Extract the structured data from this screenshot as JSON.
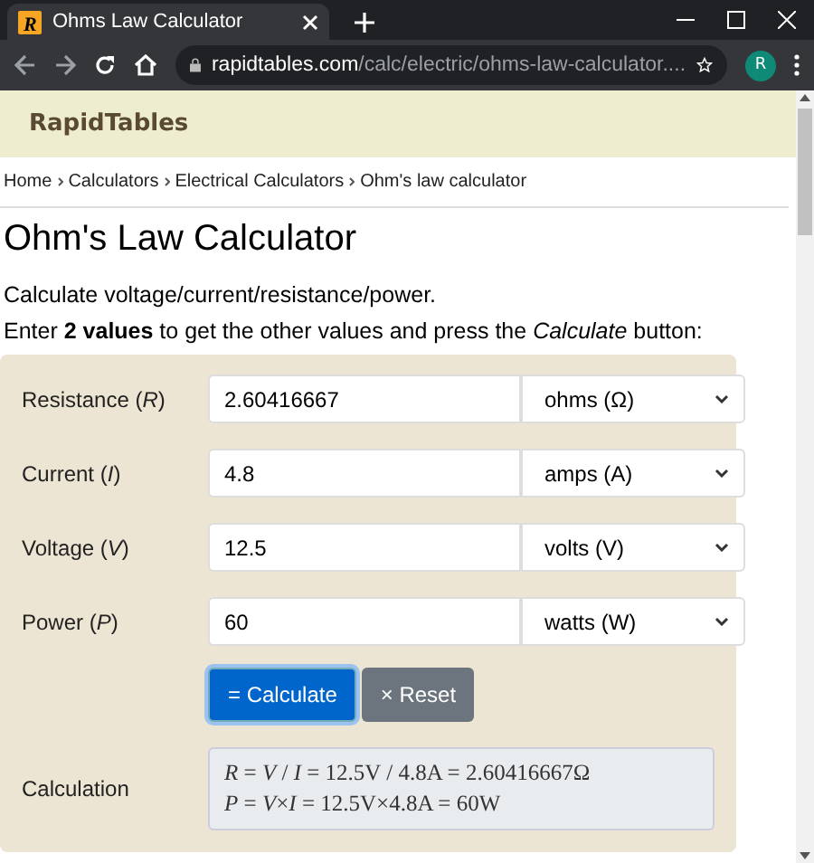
{
  "browser": {
    "favicon_letter": "R",
    "tab_title": "Ohms Law Calculator",
    "url_host": "rapidtables.com",
    "url_path": "/calc/electric/ohms-law-calculator....",
    "profile_initial": "R"
  },
  "site": {
    "name": "RapidTables"
  },
  "breadcrumb": [
    "Home",
    "Calculators",
    "Electrical Calculators",
    "Ohm's law calculator"
  ],
  "page": {
    "title": "Ohm's Law Calculator",
    "intro": "Calculate voltage/current/resistance/power.",
    "instructions": "Enter **2 values** to get the other values and press the *Calculate* button:"
  },
  "form": {
    "rows": [
      {
        "label": "Resistance (*R*)",
        "value": "2.60416667",
        "unit": "ohms (Ω)"
      },
      {
        "label": "Current (*I*)",
        "value": "4.8",
        "unit": "amps (A)"
      },
      {
        "label": "Voltage (*V*)",
        "value": "12.5",
        "unit": "volts (V)"
      },
      {
        "label": "Power (*P*)",
        "value": "60",
        "unit": "watts (W)"
      }
    ],
    "buttons": [
      {
        "kind": "primary",
        "label": "= Calculate"
      },
      {
        "kind": "secondary",
        "label": "× Reset"
      }
    ],
    "calculation": {
      "label": "Calculation",
      "lines": [
        "*R* = *V* / *I* = 12.5V / 4.8A = 2.60416667Ω",
        "*P* = *V*×*I* = 12.5V×4.8A = 60W"
      ]
    }
  }
}
